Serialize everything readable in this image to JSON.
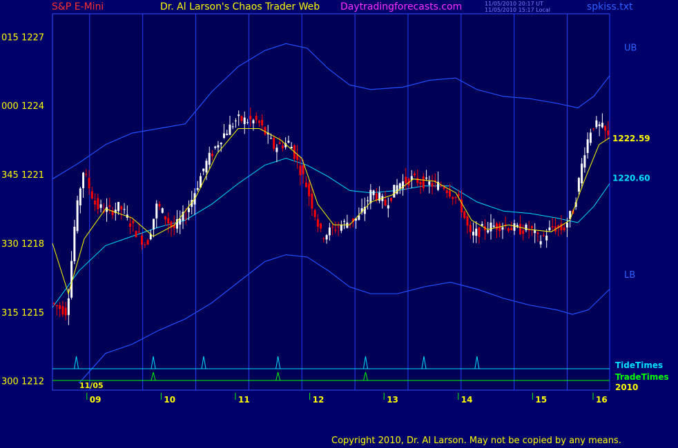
{
  "header": {
    "instrument": "S&P E-Mini",
    "title": "Dr. Al Larson's Chaos Trader Web",
    "website": "Daytradingforecasts.com",
    "time_ut": "11/05/2010 20:17 UT",
    "time_local": "11/05/2010 15:17 Local",
    "file": "spkiss.txt",
    "copyright": "Copyright 2010, Dr. Al Larson. May not be copied by any means."
  },
  "colors": {
    "background": "#00006a",
    "plot_background": "#000055",
    "up_bar": "#ffffff",
    "down_bar": "#ff0000",
    "fast_ma": "#ffff00",
    "slow_ma": "#00e0ff",
    "bands": "#2050ff",
    "time_lines": "#2040ff",
    "tide_times": "#00e0ff",
    "trade_times": "#00ff00",
    "day_labels": "#ffff00",
    "instrument": "#ff3030",
    "title": "#ffff00",
    "website": "#ff30ff",
    "file": "#3060ff"
  },
  "chart_data": {
    "type": "candlestick",
    "ylim": [
      1211.6,
      1228
    ],
    "y_ticks": [
      {
        "value": 1227,
        "label": "015 1227"
      },
      {
        "value": 1224,
        "label": "000 1224"
      },
      {
        "value": 1221,
        "label": "345 1221"
      },
      {
        "value": 1218,
        "label": "330 1218"
      },
      {
        "value": 1215,
        "label": "315 1215"
      },
      {
        "value": 1212,
        "label": "300 1212"
      }
    ],
    "day_labels": [
      "09",
      "10",
      "11",
      "12",
      "13",
      "14",
      "15",
      "16"
    ],
    "date_label": "11/05",
    "year_label": "2010",
    "last_close": "1222.59",
    "slow_ma_last": "1220.60",
    "band_labels": {
      "upper": "UB",
      "lower": "LB"
    },
    "timing_labels": {
      "tide": "TideTimes",
      "trade": "TradeTimes"
    },
    "price_path": [
      {
        "t": 0.0,
        "p": 1215.4
      },
      {
        "t": 0.3,
        "p": 1215.0
      },
      {
        "t": 0.45,
        "p": 1218.9
      },
      {
        "t": 0.6,
        "p": 1221.2
      },
      {
        "t": 0.85,
        "p": 1219.6
      },
      {
        "t": 1.1,
        "p": 1219.4
      },
      {
        "t": 1.3,
        "p": 1219.6
      },
      {
        "t": 1.6,
        "p": 1218.5
      },
      {
        "t": 1.8,
        "p": 1217.9
      },
      {
        "t": 2.0,
        "p": 1219.7
      },
      {
        "t": 2.3,
        "p": 1218.6
      },
      {
        "t": 2.55,
        "p": 1219.3
      },
      {
        "t": 2.9,
        "p": 1221.4
      },
      {
        "t": 3.2,
        "p": 1222.6
      },
      {
        "t": 3.5,
        "p": 1223.4
      },
      {
        "t": 3.9,
        "p": 1223.3
      },
      {
        "t": 4.2,
        "p": 1222.2
      },
      {
        "t": 4.5,
        "p": 1222.4
      },
      {
        "t": 4.8,
        "p": 1220.6
      },
      {
        "t": 5.1,
        "p": 1218.3
      },
      {
        "t": 5.3,
        "p": 1218.6
      },
      {
        "t": 5.55,
        "p": 1218.9
      },
      {
        "t": 5.8,
        "p": 1219.1
      },
      {
        "t": 6.05,
        "p": 1220.3
      },
      {
        "t": 6.3,
        "p": 1219.7
      },
      {
        "t": 6.55,
        "p": 1220.6
      },
      {
        "t": 6.8,
        "p": 1220.8
      },
      {
        "t": 7.1,
        "p": 1220.6
      },
      {
        "t": 7.4,
        "p": 1220.5
      },
      {
        "t": 7.7,
        "p": 1219.8
      },
      {
        "t": 7.9,
        "p": 1218.3
      },
      {
        "t": 8.2,
        "p": 1218.7
      },
      {
        "t": 8.5,
        "p": 1218.8
      },
      {
        "t": 8.8,
        "p": 1218.6
      },
      {
        "t": 9.05,
        "p": 1218.6
      },
      {
        "t": 9.2,
        "p": 1218.1
      },
      {
        "t": 9.45,
        "p": 1218.7
      },
      {
        "t": 9.65,
        "p": 1218.6
      },
      {
        "t": 9.85,
        "p": 1219.5
      },
      {
        "t": 10.05,
        "p": 1222.0
      },
      {
        "t": 10.2,
        "p": 1223.2
      },
      {
        "t": 10.4,
        "p": 1223.0
      },
      {
        "t": 10.5,
        "p": 1222.6
      }
    ],
    "fast_ma": [
      {
        "t": 0.0,
        "p": 1218.0
      },
      {
        "t": 0.3,
        "p": 1215.8
      },
      {
        "t": 0.6,
        "p": 1218.2
      },
      {
        "t": 1.0,
        "p": 1219.5
      },
      {
        "t": 1.5,
        "p": 1219.1
      },
      {
        "t": 1.9,
        "p": 1218.3
      },
      {
        "t": 2.3,
        "p": 1218.8
      },
      {
        "t": 2.7,
        "p": 1220.0
      },
      {
        "t": 3.1,
        "p": 1221.9
      },
      {
        "t": 3.5,
        "p": 1223.0
      },
      {
        "t": 3.9,
        "p": 1223.0
      },
      {
        "t": 4.3,
        "p": 1222.5
      },
      {
        "t": 4.7,
        "p": 1221.7
      },
      {
        "t": 5.0,
        "p": 1219.7
      },
      {
        "t": 5.3,
        "p": 1218.8
      },
      {
        "t": 5.6,
        "p": 1218.8
      },
      {
        "t": 6.0,
        "p": 1219.8
      },
      {
        "t": 6.4,
        "p": 1220.1
      },
      {
        "t": 6.8,
        "p": 1220.8
      },
      {
        "t": 7.2,
        "p": 1220.7
      },
      {
        "t": 7.6,
        "p": 1220.2
      },
      {
        "t": 7.9,
        "p": 1219.0
      },
      {
        "t": 8.2,
        "p": 1218.6
      },
      {
        "t": 8.6,
        "p": 1218.8
      },
      {
        "t": 9.0,
        "p": 1218.6
      },
      {
        "t": 9.4,
        "p": 1218.5
      },
      {
        "t": 9.75,
        "p": 1219.0
      },
      {
        "t": 10.0,
        "p": 1220.6
      },
      {
        "t": 10.3,
        "p": 1222.3
      },
      {
        "t": 10.5,
        "p": 1222.6
      }
    ],
    "slow_ma": [
      {
        "t": 0.0,
        "p": 1215.2
      },
      {
        "t": 0.5,
        "p": 1216.8
      },
      {
        "t": 1.0,
        "p": 1217.9
      },
      {
        "t": 1.5,
        "p": 1218.3
      },
      {
        "t": 2.0,
        "p": 1218.7
      },
      {
        "t": 2.5,
        "p": 1219.0
      },
      {
        "t": 3.0,
        "p": 1219.7
      },
      {
        "t": 3.5,
        "p": 1220.6
      },
      {
        "t": 4.0,
        "p": 1221.4
      },
      {
        "t": 4.4,
        "p": 1221.7
      },
      {
        "t": 4.8,
        "p": 1221.4
      },
      {
        "t": 5.2,
        "p": 1220.9
      },
      {
        "t": 5.6,
        "p": 1220.3
      },
      {
        "t": 6.0,
        "p": 1220.2
      },
      {
        "t": 6.5,
        "p": 1220.3
      },
      {
        "t": 7.0,
        "p": 1220.5
      },
      {
        "t": 7.5,
        "p": 1220.5
      },
      {
        "t": 8.0,
        "p": 1219.8
      },
      {
        "t": 8.5,
        "p": 1219.4
      },
      {
        "t": 9.0,
        "p": 1219.3
      },
      {
        "t": 9.5,
        "p": 1219.1
      },
      {
        "t": 9.9,
        "p": 1218.9
      },
      {
        "t": 10.2,
        "p": 1219.6
      },
      {
        "t": 10.5,
        "p": 1220.6
      }
    ],
    "upper_band": [
      {
        "t": 0.0,
        "p": 1220.8
      },
      {
        "t": 0.5,
        "p": 1221.5
      },
      {
        "t": 1.0,
        "p": 1222.3
      },
      {
        "t": 1.5,
        "p": 1222.8
      },
      {
        "t": 2.0,
        "p": 1223.0
      },
      {
        "t": 2.5,
        "p": 1223.2
      },
      {
        "t": 3.0,
        "p": 1224.6
      },
      {
        "t": 3.5,
        "p": 1225.7
      },
      {
        "t": 4.0,
        "p": 1226.4
      },
      {
        "t": 4.4,
        "p": 1226.7
      },
      {
        "t": 4.8,
        "p": 1226.5
      },
      {
        "t": 5.2,
        "p": 1225.6
      },
      {
        "t": 5.6,
        "p": 1224.9
      },
      {
        "t": 6.0,
        "p": 1224.7
      },
      {
        "t": 6.6,
        "p": 1224.8
      },
      {
        "t": 7.1,
        "p": 1225.1
      },
      {
        "t": 7.6,
        "p": 1225.2
      },
      {
        "t": 8.0,
        "p": 1224.7
      },
      {
        "t": 8.5,
        "p": 1224.4
      },
      {
        "t": 9.0,
        "p": 1224.3
      },
      {
        "t": 9.5,
        "p": 1224.1
      },
      {
        "t": 9.9,
        "p": 1223.9
      },
      {
        "t": 10.2,
        "p": 1224.4
      },
      {
        "t": 10.5,
        "p": 1225.3
      }
    ],
    "lower_band": [
      {
        "t": 0.5,
        "p": 1211.9
      },
      {
        "t": 1.0,
        "p": 1213.2
      },
      {
        "t": 1.5,
        "p": 1213.6
      },
      {
        "t": 2.0,
        "p": 1214.2
      },
      {
        "t": 2.5,
        "p": 1214.7
      },
      {
        "t": 3.0,
        "p": 1215.4
      },
      {
        "t": 3.5,
        "p": 1216.3
      },
      {
        "t": 4.0,
        "p": 1217.2
      },
      {
        "t": 4.4,
        "p": 1217.5
      },
      {
        "t": 4.8,
        "p": 1217.4
      },
      {
        "t": 5.2,
        "p": 1216.8
      },
      {
        "t": 5.6,
        "p": 1216.1
      },
      {
        "t": 6.0,
        "p": 1215.8
      },
      {
        "t": 6.5,
        "p": 1215.8
      },
      {
        "t": 7.0,
        "p": 1216.1
      },
      {
        "t": 7.5,
        "p": 1216.3
      },
      {
        "t": 8.0,
        "p": 1216.0
      },
      {
        "t": 8.5,
        "p": 1215.6
      },
      {
        "t": 9.0,
        "p": 1215.3
      },
      {
        "t": 9.5,
        "p": 1215.1
      },
      {
        "t": 9.8,
        "p": 1214.9
      },
      {
        "t": 10.1,
        "p": 1215.1
      },
      {
        "t": 10.5,
        "p": 1216.0
      }
    ],
    "day_starts": [
      0.7,
      1.7,
      2.7,
      3.7,
      4.7,
      5.7,
      6.7,
      7.7,
      8.7,
      9.7,
      10.5
    ],
    "tide_times": [
      0.45,
      1.9,
      2.85,
      4.25,
      5.9,
      7.0,
      8.0
    ],
    "trade_times": [
      1.9,
      4.25,
      5.9
    ]
  }
}
